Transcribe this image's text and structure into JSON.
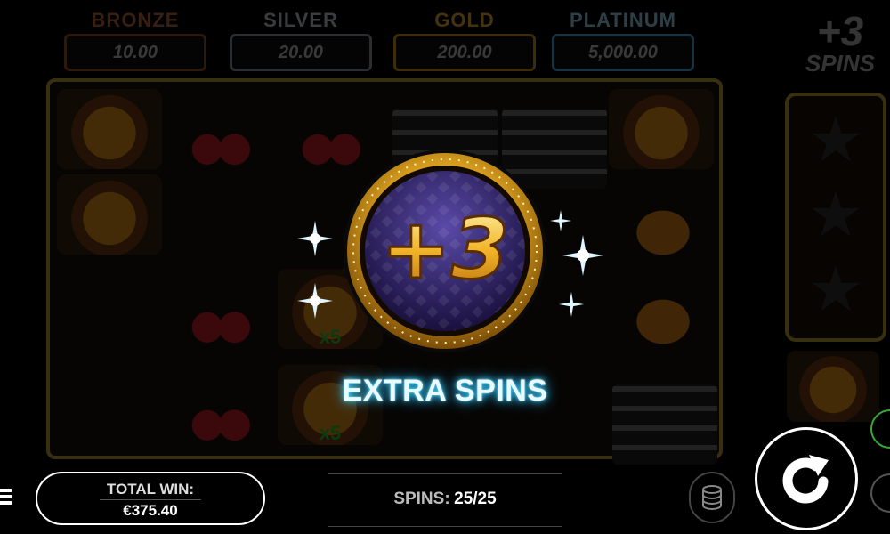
{
  "jackpots": [
    {
      "name": "BRONZE",
      "value": "10.00"
    },
    {
      "name": "SILVER",
      "value": "20.00"
    },
    {
      "name": "GOLD",
      "value": "200.00"
    },
    {
      "name": "PLATINUM",
      "value": "5,000.00"
    }
  ],
  "side_bonus": {
    "amount": "+3",
    "label": "SPINS"
  },
  "reel_labels": {
    "multiplier": "x5"
  },
  "popup": {
    "amount": "+3",
    "title": "EXTRA SPINS"
  },
  "bottom_bar": {
    "total_win_label": "TOTAL WIN:",
    "total_win_value": "€375.40",
    "spins_label": "SPINS:",
    "spins_value": "25/25"
  },
  "icons": [
    "menu-icon",
    "coin-stack-icon",
    "spin-arrow-icon",
    "sparkle-icon",
    "star-icon"
  ]
}
